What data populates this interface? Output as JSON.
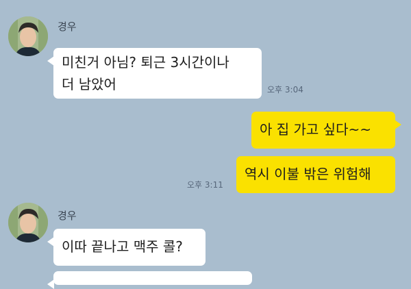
{
  "messages": [
    {
      "sender": "경우",
      "side": "left",
      "lines": [
        "미친거 아님? 퇴근 3시간이나",
        "더 남았어"
      ],
      "time": "오후 3:04"
    },
    {
      "side": "right",
      "text": "아 집 가고 싶다~~"
    },
    {
      "side": "right",
      "text": "역시 이불 밖은 위험해",
      "time": "오후 3:11"
    },
    {
      "sender": "경우",
      "side": "left",
      "text": "이따 끝나고 맥주 콜?"
    }
  ],
  "colors": {
    "background": "#a9bdce",
    "incoming_bubble": "#ffffff",
    "outgoing_bubble": "#fae100"
  },
  "icons": {
    "avatar": "profile-photo"
  }
}
